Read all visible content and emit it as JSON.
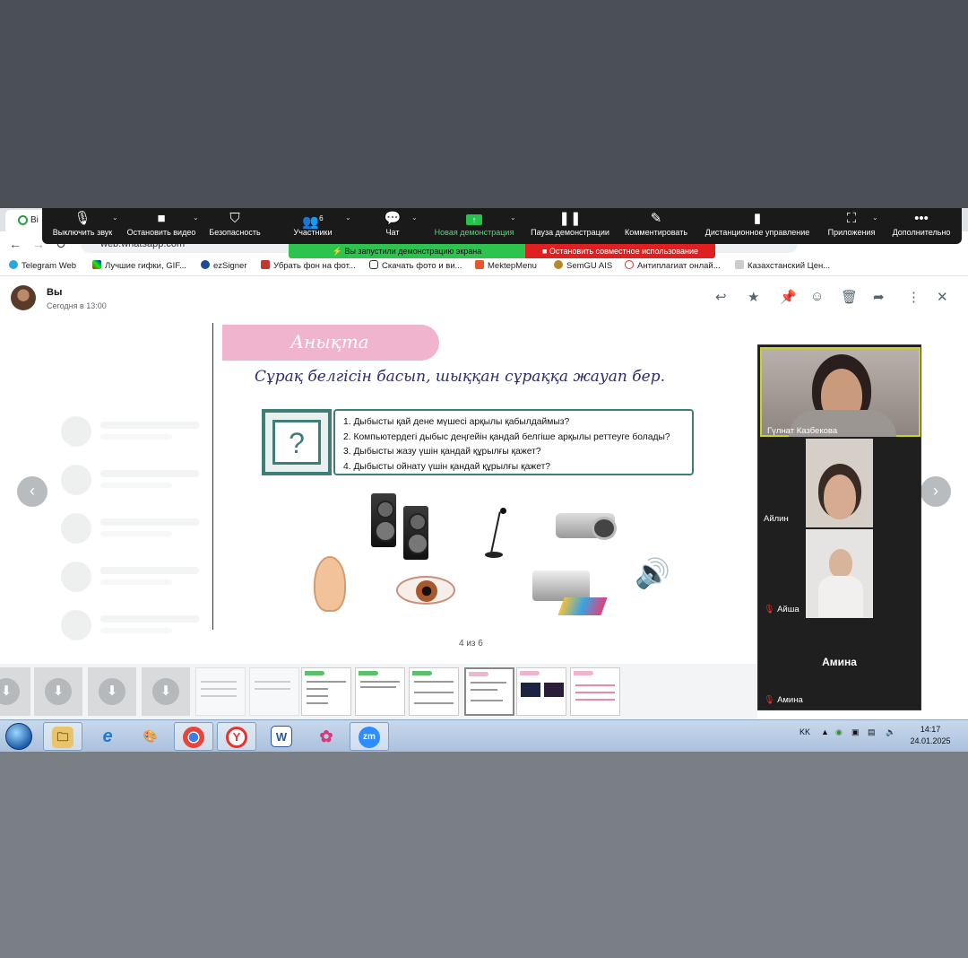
{
  "browser": {
    "tab_title": "Bi",
    "url": "web.whatsapp.com",
    "bookmarks": [
      {
        "label": "Telegram Web",
        "color": "#2ca5e0"
      },
      {
        "label": "Лучшие гифки, GIF...",
        "color": "#6b3fa0"
      },
      {
        "label": "ezSigner",
        "color": "#1b4a8f"
      },
      {
        "label": "Убрать фон на фот...",
        "color": "#c0392b"
      },
      {
        "label": "Скачать фото и ви...",
        "color": "#333333"
      },
      {
        "label": "MektepMenu",
        "color": "#e8552e"
      },
      {
        "label": "SemGU AIS",
        "color": "#b58b2a"
      },
      {
        "label": "Антиплагиат онлай...",
        "color": "#d33b3b"
      },
      {
        "label": "Казахстанский Цен...",
        "color": "#888888"
      }
    ]
  },
  "zoom": {
    "toolbar": [
      {
        "label": "Выключить звук",
        "icon": "microphone-icon"
      },
      {
        "label": "Остановить видео",
        "icon": "video-camera-icon"
      },
      {
        "label": "Безопасность",
        "icon": "shield-icon"
      },
      {
        "label": "Участники",
        "icon": "participants-icon",
        "count": "6"
      },
      {
        "label": "Чат",
        "icon": "chat-icon"
      },
      {
        "label": "Новая демонстрация",
        "icon": "share-screen-icon"
      },
      {
        "label": "Пауза демонстрации",
        "icon": "pause-icon"
      },
      {
        "label": "Комментировать",
        "icon": "pencil-icon"
      },
      {
        "label": "Дистанционное управление",
        "icon": "mouse-icon"
      },
      {
        "label": "Приложения",
        "icon": "apps-icon"
      },
      {
        "label": "Дополнительно",
        "icon": "more-icon"
      }
    ],
    "sharing_banner": "Вы запустили демонстрацию экрана",
    "stop_sharing": "Остановить совместное использование",
    "accent_green": "#2dc44e",
    "accent_red": "#e02020"
  },
  "whatsapp": {
    "sender": "Вы",
    "sent_time": "Сегодня в 13:00",
    "pager": "4 из 6"
  },
  "slide": {
    "heading": "Анықта",
    "instruction": "Сұрақ белгісін басып, шыққан сұраққа жауап бер.",
    "question_mark": "?",
    "questions": [
      "1.  Дыбысты қай дене мүшесі арқылы қабылдаймыз?",
      "2.  Компьютердегі дыбыс деңгейін қандай белгіше арқылы реттеуге болады?",
      "3.  Дыбысты жазу үшін қандай құрылғы қажет?",
      "4.  Дыбысты ойнату үшін қандай құрылғы қажет?"
    ]
  },
  "participants": [
    {
      "name": "Гүлнат Казбекова"
    },
    {
      "name": "Айлин"
    },
    {
      "name": "Айша"
    },
    {
      "name": "Амина",
      "display": "Амина"
    }
  ],
  "taskbar": {
    "apps": [
      {
        "name": "explorer",
        "glyph": "🗀"
      },
      {
        "name": "ie",
        "glyph": "e"
      },
      {
        "name": "paint",
        "glyph": "🎨"
      },
      {
        "name": "chrome",
        "glyph": "◉"
      },
      {
        "name": "yandex",
        "glyph": "Y"
      },
      {
        "name": "word",
        "glyph": "W"
      },
      {
        "name": "picasa",
        "glyph": "✿"
      },
      {
        "name": "zoom",
        "glyph": "zm"
      }
    ],
    "language": "KK",
    "time": "14:17",
    "date": "24.01.2025"
  }
}
